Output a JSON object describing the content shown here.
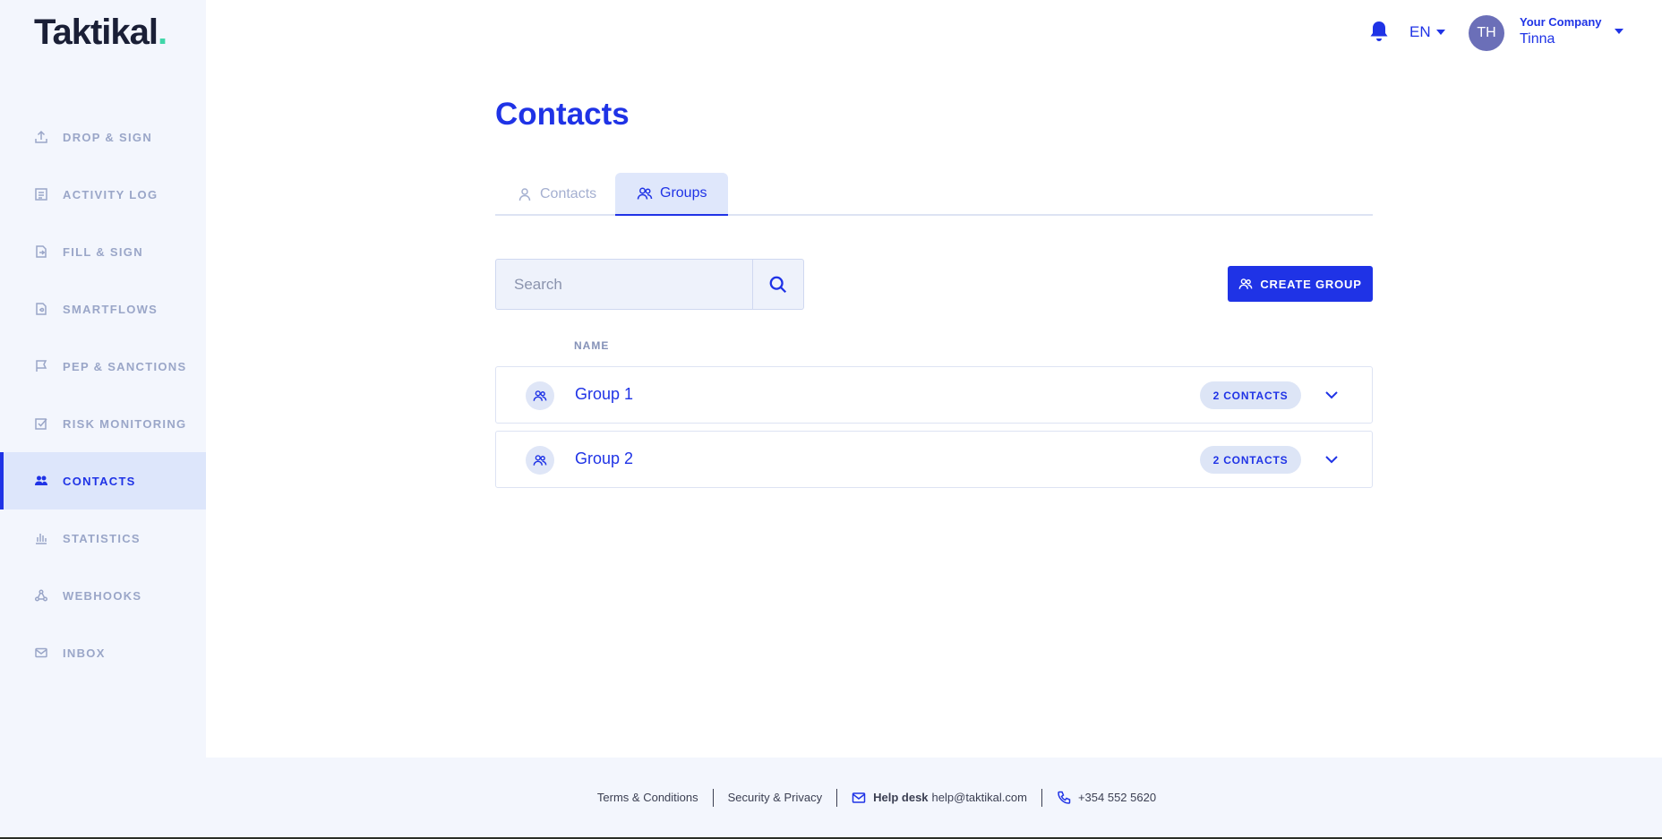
{
  "brand": {
    "logo_text": "Taktikal",
    "logo_dot": ".",
    "accent": "#1f33e6",
    "dot_color": "#3fd6a8"
  },
  "sidebar": {
    "items": [
      {
        "label": "DROP & SIGN",
        "icon": "upload-icon"
      },
      {
        "label": "ACTIVITY LOG",
        "icon": "log-icon"
      },
      {
        "label": "FILL & SIGN",
        "icon": "fill-sign-icon"
      },
      {
        "label": "SMARTFLOWS",
        "icon": "smartflow-icon"
      },
      {
        "label": "PEP & SANCTIONS",
        "icon": "flag-icon"
      },
      {
        "label": "RISK MONITORING",
        "icon": "checkbox-icon"
      },
      {
        "label": "CONTACTS",
        "icon": "people-icon",
        "active": true
      },
      {
        "label": "STATISTICS",
        "icon": "bar-chart-icon"
      },
      {
        "label": "WEBHOOKS",
        "icon": "webhook-icon"
      },
      {
        "label": "INBOX",
        "icon": "mail-icon"
      }
    ]
  },
  "topbar": {
    "language": "EN",
    "avatar_initials": "TH",
    "company": "Your Company",
    "user": "Tinna"
  },
  "main": {
    "title": "Contacts",
    "tabs": [
      {
        "label": "Contacts",
        "active": false
      },
      {
        "label": "Groups",
        "active": true
      }
    ],
    "search": {
      "placeholder": "Search",
      "value": ""
    },
    "create_button": "CREATE GROUP",
    "column_name": "NAME",
    "groups": [
      {
        "name": "Group 1",
        "badge": "2 CONTACTS"
      },
      {
        "name": "Group 2",
        "badge": "2 CONTACTS"
      }
    ]
  },
  "footer": {
    "terms": "Terms & Conditions",
    "security": "Security & Privacy",
    "helpdesk_label": "Help desk",
    "helpdesk_email": "help@taktikal.com",
    "phone": "+354 552 5620"
  }
}
